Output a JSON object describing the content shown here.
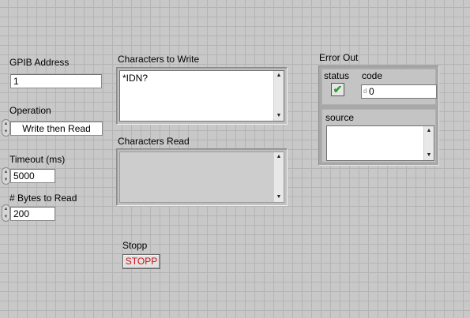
{
  "gpib": {
    "label": "GPIB Address",
    "value": "1"
  },
  "operation": {
    "label": "Operation",
    "value": "Write then Read"
  },
  "timeout": {
    "label": "Timeout (ms)",
    "value": "5000"
  },
  "bytes_to_read": {
    "label": "# Bytes to Read",
    "value": "200"
  },
  "chars_to_write": {
    "label": "Characters to Write",
    "value": "*IDN?"
  },
  "chars_read": {
    "label": "Characters Read",
    "value": ""
  },
  "stop": {
    "label": "Stopp",
    "button": "STOPP",
    "button_color": "#cc1111"
  },
  "error_out": {
    "label": "Error Out",
    "status_label": "status",
    "code_label": "code",
    "code_value": "0",
    "code_radix": "d",
    "source_label": "source",
    "source_value": "",
    "status_color": "#2aa02a"
  },
  "icons": {
    "spinner": "up-down-spinner-icon",
    "scroll_up": "scroll-up-arrow-icon",
    "scroll_down": "scroll-down-arrow-icon",
    "status_ok": "checkmark-icon"
  }
}
